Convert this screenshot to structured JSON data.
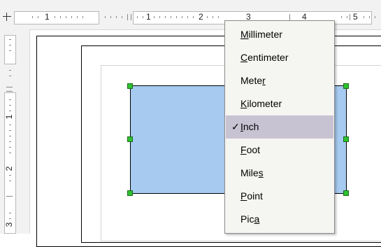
{
  "ruler": {
    "horizontal_numbers": [
      "1",
      "1",
      "2",
      "3",
      "4",
      "5"
    ],
    "vertical_numbers": [
      "1",
      "2",
      "3"
    ]
  },
  "menu": {
    "items": [
      {
        "label": "Millimeter",
        "mnemonic": "M",
        "checked": false
      },
      {
        "label": "Centimeter",
        "mnemonic": "C",
        "checked": false
      },
      {
        "label": "Meter",
        "mnemonic": "r",
        "checked": false
      },
      {
        "label": "Kilometer",
        "mnemonic": "K",
        "checked": false
      },
      {
        "label": "Inch",
        "mnemonic": "I",
        "checked": true
      },
      {
        "label": "Foot",
        "mnemonic": "F",
        "checked": false
      },
      {
        "label": "Miles",
        "mnemonic": "s",
        "checked": false
      },
      {
        "label": "Point",
        "mnemonic": "P",
        "checked": false
      },
      {
        "label": "Pica",
        "mnemonic": "a",
        "checked": false
      }
    ],
    "check_glyph": "✓"
  },
  "colors": {
    "shape_fill": "#a6caf0",
    "handle_fill": "#2ec22e",
    "selected_item_bg": "#c8c3d3"
  }
}
